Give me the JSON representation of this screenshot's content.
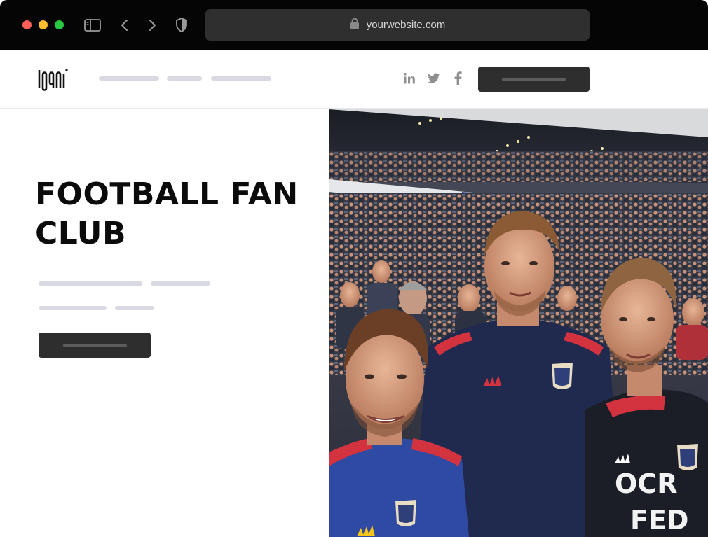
{
  "browser": {
    "url": "yourwebsite.com",
    "icons": [
      "sidebar-icon",
      "back-icon",
      "forward-icon",
      "shield-icon",
      "lock-icon"
    ]
  },
  "header": {
    "logo_text": "LOGO",
    "social": [
      {
        "name": "linkedin-icon",
        "glyph": "in"
      },
      {
        "name": "twitter-icon",
        "glyph": "twitter"
      },
      {
        "name": "facebook-icon",
        "glyph": "f"
      }
    ]
  },
  "hero": {
    "title_line1": "FOOTBALL FAN",
    "title_line2": "CLUB"
  },
  "photo": {
    "jersey_text_1": "OCR",
    "jersey_text_2": "FED"
  },
  "colors": {
    "chrome": "#050505",
    "address_bar": "#2f2f2f",
    "button": "#2e2e2e",
    "placeholder_line": "#d9d9e3",
    "title": "#0b0b0b"
  }
}
